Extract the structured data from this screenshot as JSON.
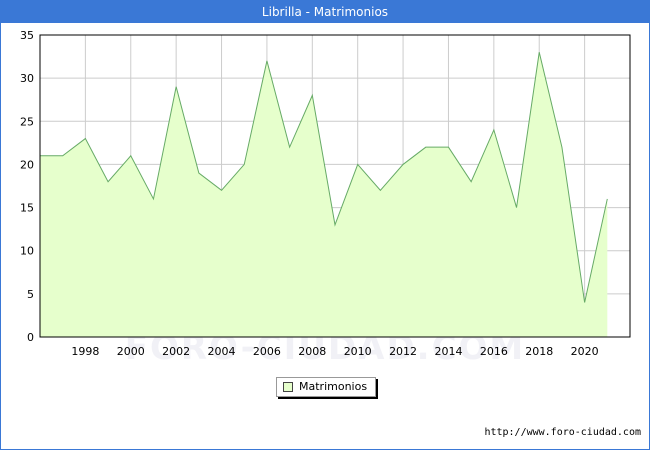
{
  "title": "Librilla - Matrimonios",
  "watermark": "FORO-CIUDAD.COM",
  "source_url": "http://www.foro-ciudad.com",
  "colors": {
    "title_bar": "#3a78d6",
    "area_fill": "#e6ffcc",
    "line": "#66aa66",
    "grid": "#cccccc"
  },
  "chart_data": {
    "type": "area",
    "title": "Librilla - Matrimonios",
    "x": [
      1996,
      1997,
      1998,
      1999,
      2000,
      2001,
      2002,
      2003,
      2004,
      2005,
      2006,
      2007,
      2008,
      2009,
      2010,
      2011,
      2012,
      2013,
      2014,
      2015,
      2016,
      2017,
      2018,
      2019,
      2020,
      2021
    ],
    "series": [
      {
        "name": "Matrimonios",
        "values": [
          21,
          21,
          23,
          18,
          21,
          16,
          29,
          19,
          17,
          20,
          32,
          22,
          28,
          13,
          20,
          17,
          20,
          22,
          22,
          18,
          24,
          15,
          33,
          22,
          4,
          16
        ]
      }
    ],
    "xticks": [
      "1998",
      "2000",
      "2002",
      "2004",
      "2006",
      "2008",
      "2010",
      "2012",
      "2014",
      "2016",
      "2018",
      "2020"
    ],
    "yticks": [
      "0",
      "5",
      "10",
      "15",
      "20",
      "25",
      "30",
      "35"
    ],
    "xlim": [
      1996,
      2022
    ],
    "ylim": [
      0,
      35
    ],
    "grid": true,
    "legend_position": "bottom-center"
  }
}
